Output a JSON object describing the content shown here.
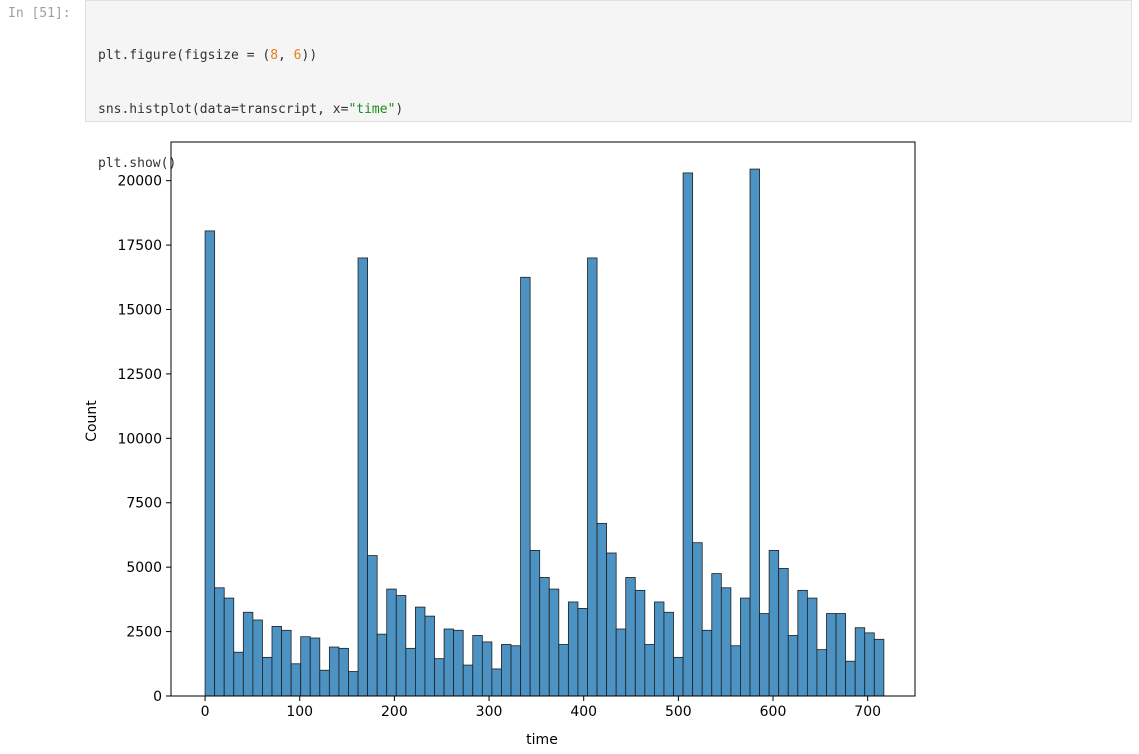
{
  "cell": {
    "prompt": "In [51]:",
    "code": {
      "line1": {
        "a": "plt.figure(figsize = (",
        "n1": "8",
        "b": ", ",
        "n2": "6",
        "c": "))"
      },
      "line2": {
        "a": "sns.histplot(data=transcript, x=",
        "s": "\"time\"",
        "b": ")"
      },
      "line3": "plt.show()"
    }
  },
  "chart_data": {
    "type": "bar",
    "xlabel": "time",
    "ylabel": "Count",
    "xlim": [
      -36,
      750
    ],
    "ylim": [
      0,
      21500
    ],
    "xticks": [
      0,
      100,
      200,
      300,
      400,
      500,
      600,
      700
    ],
    "yticks": [
      0,
      2500,
      5000,
      7500,
      10000,
      12500,
      15000,
      17500,
      20000
    ],
    "bin_width": 10.1,
    "bin_start": 0,
    "values": [
      18050,
      4200,
      3800,
      1700,
      3250,
      2950,
      1500,
      2700,
      2550,
      1250,
      2300,
      2250,
      1000,
      1900,
      1850,
      950,
      17000,
      5450,
      2400,
      4150,
      3900,
      1850,
      3450,
      3100,
      1450,
      2600,
      2550,
      1200,
      2350,
      2100,
      1050,
      2000,
      1950,
      16250,
      5650,
      4600,
      4150,
      2000,
      3650,
      3400,
      17000,
      6700,
      5550,
      2600,
      4600,
      4100,
      2000,
      3650,
      3250,
      1500,
      20300,
      5950,
      2550,
      4750,
      4200,
      1950,
      3800,
      20450,
      3200,
      5650,
      4950,
      2350,
      4100,
      3800,
      1800,
      3200,
      3200,
      1350,
      2650,
      2450,
      2200
    ],
    "bar_color": "#4c92c3",
    "edge_color": "#1f1f1f"
  }
}
